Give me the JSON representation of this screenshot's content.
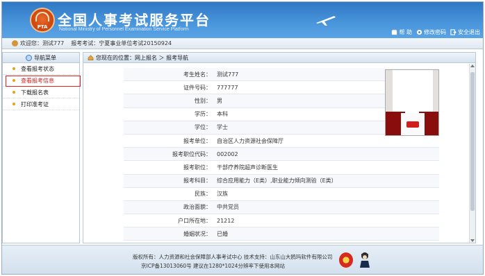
{
  "header": {
    "logo_text": "PTA",
    "title": "全国人事考试服务平台",
    "subtitle": "National Ministry of Personnel Examination Service Platform",
    "links": [
      {
        "label": "帮 助",
        "icon": "help-icon"
      },
      {
        "label": "修改密码",
        "icon": "key-icon"
      },
      {
        "label": "安全退出",
        "icon": "logout-icon"
      }
    ]
  },
  "welcome": {
    "greeting": "欢迎您：测试777",
    "exam": "报考考试：宁夏事业单位考试20150924"
  },
  "sidebar": {
    "title": "导航菜单",
    "items": [
      {
        "label": "查看报考状态"
      },
      {
        "label": "查看报考信息"
      },
      {
        "label": "下载报名表"
      },
      {
        "label": "打印准考证"
      }
    ]
  },
  "breadcrumb": "您现在的位置：网上报名 ＞ 报考导航",
  "fields": [
    {
      "label": "考生姓名：",
      "value": "测试777"
    },
    {
      "label": "证件号码：",
      "value": "777777"
    },
    {
      "label": "性别：",
      "value": "男"
    },
    {
      "label": "学历：",
      "value": "本科"
    },
    {
      "label": "学位：",
      "value": "学士"
    },
    {
      "label": "报考单位：",
      "value": "自治区人力资源社会保障厅"
    },
    {
      "label": "报考职位代码：",
      "value": "002002"
    },
    {
      "label": "报考职位：",
      "value": "干部疗养院超声诊断医生"
    },
    {
      "label": "报考科目：",
      "value": "综合应用能力（E类）,职业能力倾向测验（E类）"
    },
    {
      "label": "民族：",
      "value": "汉族"
    },
    {
      "label": "政治面貌：",
      "value": "中共党员"
    },
    {
      "label": "户口所在地：",
      "value": "21212"
    },
    {
      "label": "婚姻状况：",
      "value": "已婚"
    }
  ],
  "footer": {
    "line1": "版权所有：人力资源和社会保障部人事考试中心  技术支持：山东山大鸥玛软件有限公司",
    "line2": "京ICP备13013060号  建议在1280*1024分辨率下使用本网站"
  }
}
